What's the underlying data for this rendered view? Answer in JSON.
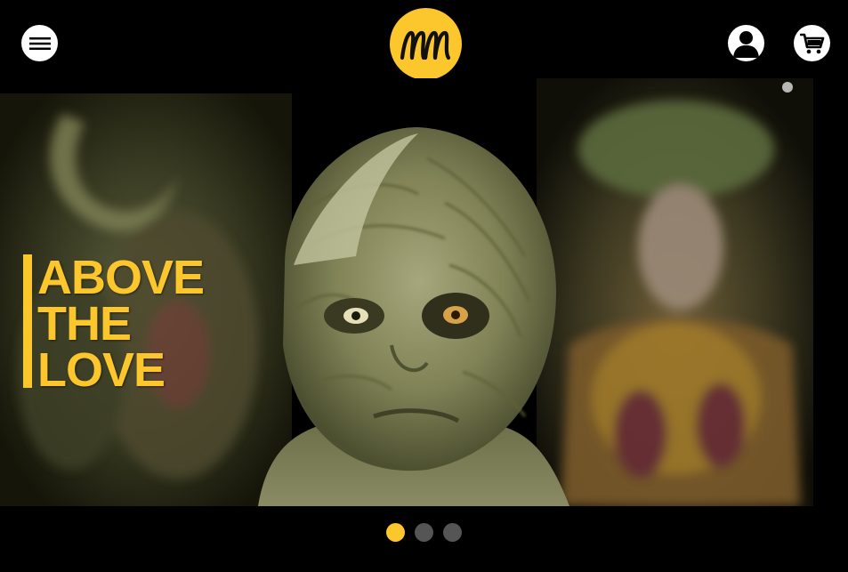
{
  "header": {
    "logo_text": "MM",
    "menu_icon": "hamburger-icon",
    "account_icon": "user-icon",
    "cart_icon": "cart-icon"
  },
  "hero": {
    "headline_lines": [
      "ABOVE",
      "THE",
      "LOVE"
    ],
    "image": "creature-makeup-collage"
  },
  "slider": {
    "slides_count": 3,
    "active_index": 0
  },
  "colors": {
    "accent": "#fcc62d",
    "background": "#000000",
    "dot_inactive": "#555555"
  }
}
